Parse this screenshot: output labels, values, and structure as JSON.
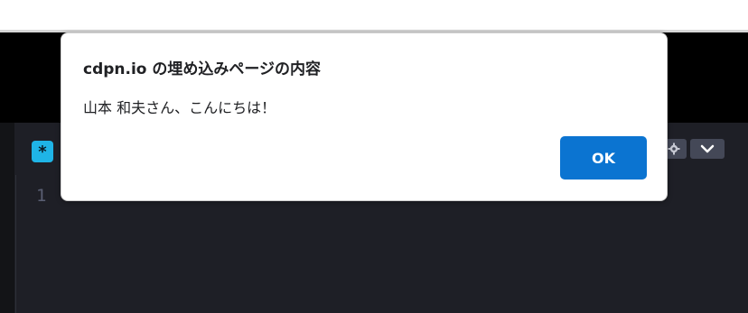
{
  "editor": {
    "css_badge_symbol": "*",
    "line_number": "1",
    "settings_icon": "gear-icon",
    "collapse_icon": "chevron-down-icon"
  },
  "dialog": {
    "title": "cdpn.io の埋め込みページの内容",
    "message": "山本 和夫さん、こんにちは！",
    "ok_label": "OK"
  },
  "colors": {
    "ok_button": "#0b74d1",
    "css_badge": "#1fb4e6",
    "editor_background": "#1e1f26",
    "header_background": "#000000",
    "toolbar_button": "#444857"
  }
}
